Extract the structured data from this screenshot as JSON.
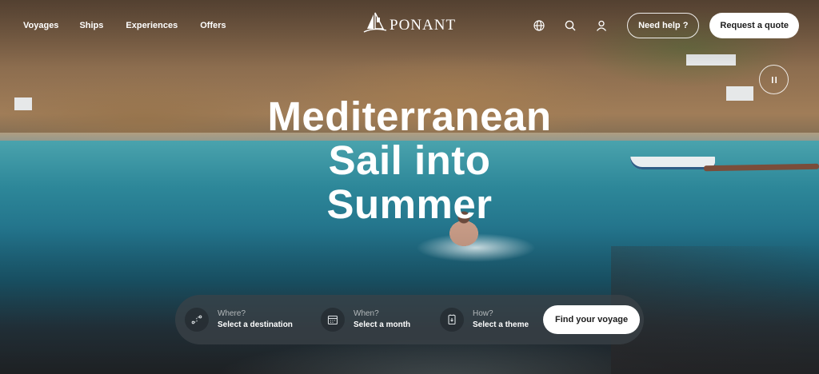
{
  "nav": {
    "items": [
      {
        "label": "Voyages"
      },
      {
        "label": "Ships"
      },
      {
        "label": "Experiences"
      },
      {
        "label": "Offers"
      }
    ]
  },
  "logo": {
    "text": "PONANT"
  },
  "header_actions": {
    "icons": [
      "globe-icon",
      "search-icon",
      "user-icon"
    ],
    "help_label": "Need help ?",
    "quote_label": "Request a quote"
  },
  "media_control": {
    "icon": "pause-icon"
  },
  "hero": {
    "line1": "Mediterranean",
    "line2": "Sail into",
    "line3": "Summer"
  },
  "search": {
    "fields": [
      {
        "label": "Where?",
        "value": "Select a destination",
        "icon": "route-icon"
      },
      {
        "label": "When?",
        "value": "Select a month",
        "icon": "calendar-icon"
      },
      {
        "label": "How?",
        "value": "Select a theme",
        "icon": "theme-icon"
      }
    ],
    "cta_label": "Find your voyage"
  }
}
